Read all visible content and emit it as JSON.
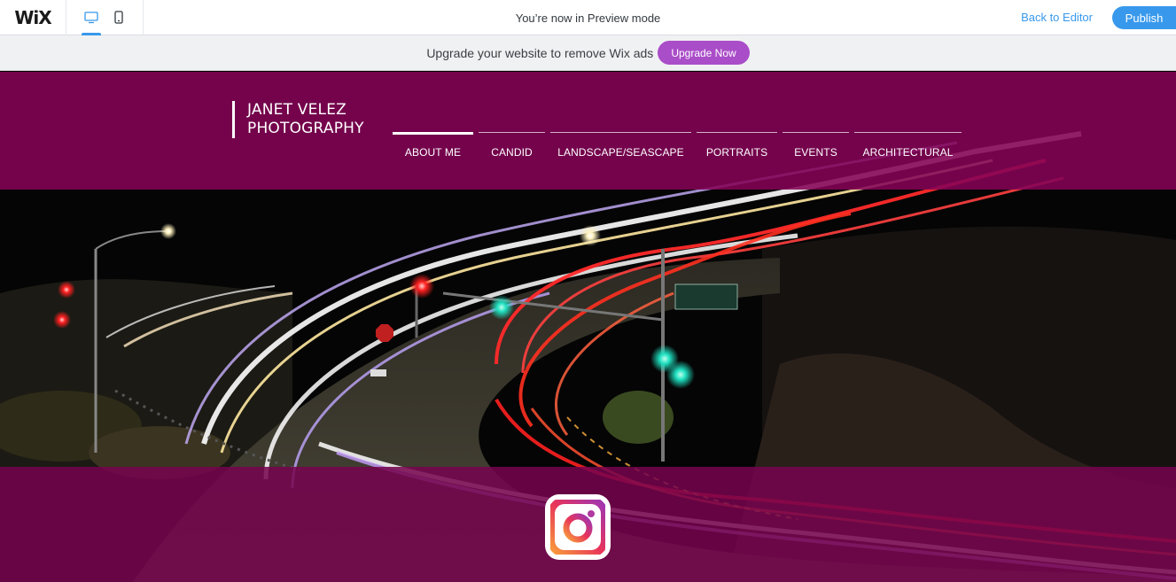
{
  "wix_bar": {
    "logo": "WiX",
    "preview_text": "You’re now in Preview mode",
    "back_to_editor": "Back to Editor",
    "publish": "Publish",
    "desktop_icon": "desktop-icon",
    "mobile_icon": "mobile-icon",
    "accent": "#3899ec"
  },
  "ad_bar": {
    "text": "Upgrade your website to remove Wix ads",
    "button": "Upgrade Now",
    "button_color": "#aa4dc8"
  },
  "site": {
    "logo_line1": "JANET VELEZ",
    "logo_line2": "PHOTOGRAPHY",
    "nav": [
      {
        "label": "ABOUT ME",
        "active": true
      },
      {
        "label": "CANDID",
        "active": false
      },
      {
        "label": "LANDSCAPE/SEASCAPE",
        "active": false
      },
      {
        "label": "PORTRAITS",
        "active": false
      },
      {
        "label": "EVENTS",
        "active": false
      },
      {
        "label": "ARCHITECTURAL",
        "active": false
      }
    ],
    "overlay_color": "#840356",
    "social_icon": "instagram-icon"
  }
}
